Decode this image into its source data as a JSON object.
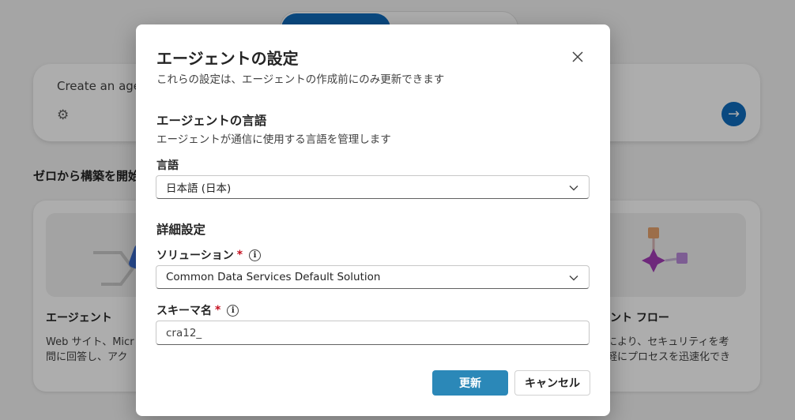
{
  "background": {
    "prompt_placeholder": "Create an age",
    "section_title": "ゼロから構築を開始",
    "card_left": {
      "title": "エージェント",
      "desc": "Web サイト、Micr\n問に回答し、アク"
    },
    "card_right": {
      "title": "ェント フロー",
      "desc": "により、セキュリティを考\n軽にプロセスを迅速化でき"
    }
  },
  "dialog": {
    "title": "エージェントの設定",
    "subtitle": "これらの設定は、エージェントの作成前にのみ更新できます",
    "close_icon": "close-icon",
    "language_section": {
      "title": "エージェントの言語",
      "subtitle": "エージェントが通信に使用する言語を管理します",
      "field_label": "言語",
      "selected": "日本語 (日本)"
    },
    "advanced_section": {
      "title": "詳細設定",
      "solution_label": "ソリューション",
      "solution_selected": "Common Data Services Default Solution",
      "schema_label": "スキーマ名",
      "schema_value": "cra12_"
    },
    "required_marker": "*",
    "update_button": "更新",
    "cancel_button": "キャンセル"
  },
  "colors": {
    "primary": "#2b88b8",
    "brand": "#0f6cbd",
    "required": "#c50f1f"
  }
}
